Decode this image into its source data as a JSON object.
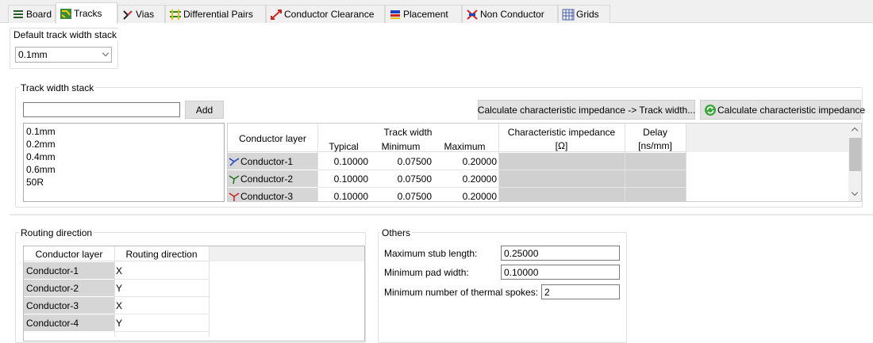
{
  "tabs": [
    {
      "label": "Board",
      "icon": "board-icon"
    },
    {
      "label": "Tracks",
      "icon": "tracks-icon",
      "active": true
    },
    {
      "label": "Vias",
      "icon": "vias-icon"
    },
    {
      "label": "Differential Pairs",
      "icon": "differential-pairs-icon"
    },
    {
      "label": "Conductor Clearance",
      "icon": "conductor-clearance-icon"
    },
    {
      "label": "Placement",
      "icon": "placement-icon"
    },
    {
      "label": "Non Conductor",
      "icon": "non-conductor-icon"
    },
    {
      "label": "Grids",
      "icon": "grids-icon"
    }
  ],
  "default_stack": {
    "label": "Default track width stack",
    "value": "0.1mm"
  },
  "track_width_stack": {
    "label": "Track width stack",
    "name_input": "",
    "add_label": "Add",
    "items": [
      "0.1mm",
      "0.2mm",
      "0.4mm",
      "0.6mm",
      "50R"
    ],
    "calc_track_width_label": "Calculate characteristic impedance -> Track width...",
    "calc_impedance_label": "Calculate characteristic impedance",
    "table": {
      "col_layer": "Conductor layer",
      "col_track_width": "Track width",
      "col_typical": "Typical",
      "col_minimum": "Minimum",
      "col_maximum": "Maximum",
      "col_impedance": "Characteristic impedance",
      "col_impedance_unit": "[Ω]",
      "col_delay": "Delay",
      "col_delay_unit": "[ns/mm]",
      "rows": [
        {
          "layer": "Conductor-1",
          "typical": "0.10000",
          "minimum": "0.07500",
          "maximum": "0.20000"
        },
        {
          "layer": "Conductor-2",
          "typical": "0.10000",
          "minimum": "0.07500",
          "maximum": "0.20000"
        },
        {
          "layer": "Conductor-3",
          "typical": "0.10000",
          "minimum": "0.07500",
          "maximum": "0.20000"
        }
      ]
    }
  },
  "routing": {
    "label": "Routing direction",
    "col_layer": "Conductor layer",
    "col_direction": "Routing direction",
    "rows": [
      {
        "layer": "Conductor-1",
        "direction": "X"
      },
      {
        "layer": "Conductor-2",
        "direction": "Y"
      },
      {
        "layer": "Conductor-3",
        "direction": "X"
      },
      {
        "layer": "Conductor-4",
        "direction": "Y"
      }
    ]
  },
  "others": {
    "label": "Others",
    "max_stub_label": "Maximum stub length:",
    "max_stub_value": "0.25000",
    "min_pad_label": "Minimum pad width:",
    "min_pad_value": "0.10000",
    "min_spokes_label": "Minimum number of thermal spokes:",
    "min_spokes_value": "2"
  }
}
